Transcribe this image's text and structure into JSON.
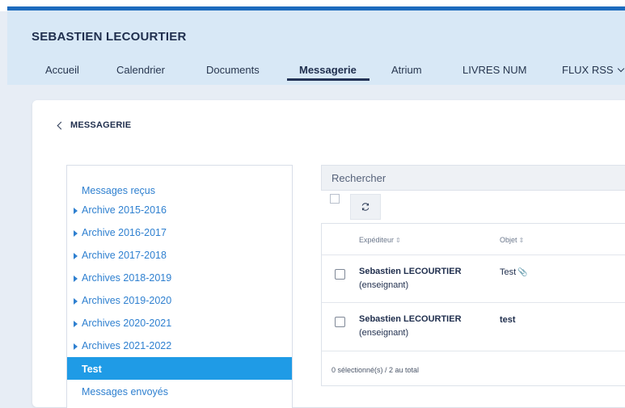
{
  "header": {
    "user_name": "SEBASTIEN LECOURTIER"
  },
  "nav": {
    "tabs": [
      {
        "label": "Accueil"
      },
      {
        "label": "Calendrier"
      },
      {
        "label": "Documents"
      },
      {
        "label": "Messagerie",
        "active": true
      },
      {
        "label": "Atrium"
      },
      {
        "label": "LIVRES NUM"
      },
      {
        "label": "FLUX RSS"
      }
    ]
  },
  "messagerie": {
    "back_label": "MESSAGERIE"
  },
  "folders": [
    {
      "label": "Messages reçus",
      "caret": false
    },
    {
      "label": "Archive 2015-2016",
      "caret": true
    },
    {
      "label": "Archive 2016-2017",
      "caret": true
    },
    {
      "label": "Archive 2017-2018",
      "caret": true
    },
    {
      "label": "Archives 2018-2019",
      "caret": true
    },
    {
      "label": "Archives 2019-2020",
      "caret": true
    },
    {
      "label": "Archives 2020-2021",
      "caret": true
    },
    {
      "label": "Archives 2021-2022",
      "caret": true
    },
    {
      "label": "Test",
      "caret": false,
      "selected": true
    },
    {
      "label": "Messages envoyés",
      "caret": false
    }
  ],
  "search": {
    "placeholder": "Rechercher"
  },
  "table": {
    "col_sender": "Expéditeur",
    "col_subject": "Objet",
    "rows": [
      {
        "sender_name": "Sebastien LECOURTIER",
        "sender_role": "(enseignant)",
        "subject": "Test",
        "attachment": true
      },
      {
        "sender_name": "Sebastien LECOURTIER",
        "sender_role": "(enseignant)",
        "subject": "test",
        "attachment": false
      }
    ],
    "footer": "0 sélectionné(s) / 2 au total"
  },
  "colors": {
    "accent": "#1d6bbd",
    "header_bg": "#d8e8f6",
    "selected_folder": "#1f9be6",
    "link": "#2f80d0"
  }
}
